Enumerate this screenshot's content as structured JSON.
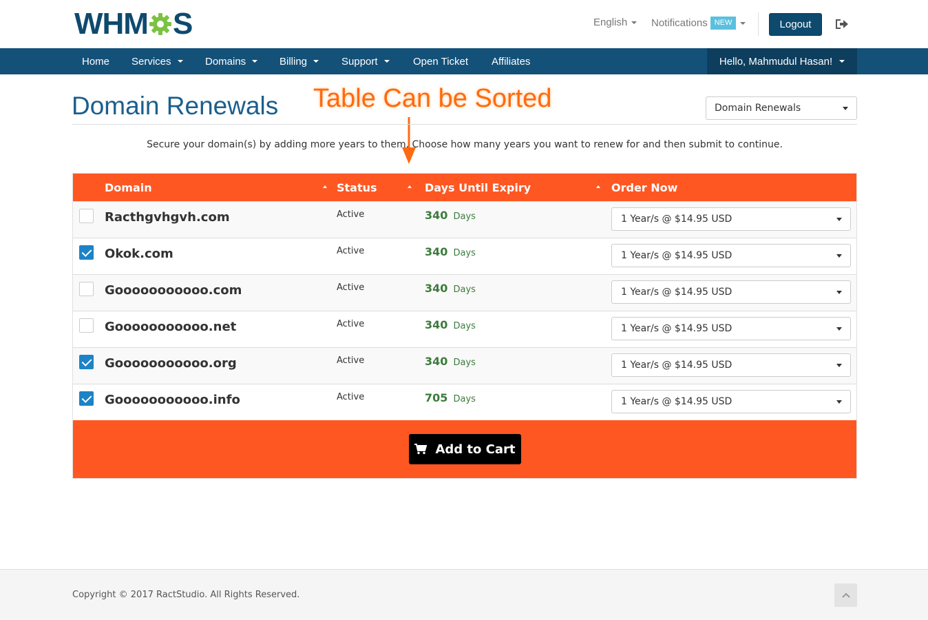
{
  "header": {
    "logo_text_left": "WHM",
    "logo_text_right": "S",
    "language": "English",
    "notifications": "Notifications",
    "notifications_badge": "NEW",
    "logout": "Logout"
  },
  "nav": {
    "items": [
      {
        "label": "Home",
        "dropdown": false
      },
      {
        "label": "Services",
        "dropdown": true
      },
      {
        "label": "Domains",
        "dropdown": true
      },
      {
        "label": "Billing",
        "dropdown": true
      },
      {
        "label": "Support",
        "dropdown": true
      },
      {
        "label": "Open Ticket",
        "dropdown": false
      },
      {
        "label": "Affiliates",
        "dropdown": false
      }
    ],
    "user": "Hello, Mahmudul Hasan!"
  },
  "page": {
    "title": "Domain Renewals",
    "annotation": "Table Can be Sorted",
    "select_value": "Domain Renewals",
    "intro": "Secure your domain(s) by adding more years to them. Choose how many years you want to renew for and then submit to continue."
  },
  "table": {
    "headers": {
      "domain": "Domain",
      "status": "Status",
      "days": "Days Until Expiry",
      "order": "Order Now"
    },
    "days_label": "Days",
    "rows": [
      {
        "domain": "Racthgvhgvh.com",
        "status": "Active",
        "days": "340",
        "checked": false,
        "term": "1 Year/s @ $14.95 USD"
      },
      {
        "domain": "Okok.com",
        "status": "Active",
        "days": "340",
        "checked": true,
        "term": "1 Year/s @ $14.95 USD"
      },
      {
        "domain": "Gooooooooooo.com",
        "status": "Active",
        "days": "340",
        "checked": false,
        "term": "1 Year/s @ $14.95 USD"
      },
      {
        "domain": "Gooooooooooo.net",
        "status": "Active",
        "days": "340",
        "checked": false,
        "term": "1 Year/s @ $14.95 USD"
      },
      {
        "domain": "Gooooooooooo.org",
        "status": "Active",
        "days": "340",
        "checked": true,
        "term": "1 Year/s @ $14.95 USD"
      },
      {
        "domain": "Gooooooooooo.info",
        "status": "Active",
        "days": "705",
        "checked": true,
        "term": "1 Year/s @ $14.95 USD"
      }
    ],
    "add_to_cart": "Add to Cart"
  },
  "footer": {
    "copyright": "Copyright © 2017 RactStudio. All Rights Reserved."
  },
  "colors": {
    "brand": "#0e4a6e",
    "nav": "#145179",
    "accent": "#ff5722",
    "days": "#3c7b3c",
    "checkbox": "#1d83c6"
  },
  "icons": [
    "gear-icon",
    "sign-out-icon",
    "cart-icon",
    "chevron-up-icon",
    "caret-down-icon",
    "sort-icon",
    "arrow-down-icon",
    "checkmark-icon"
  ]
}
